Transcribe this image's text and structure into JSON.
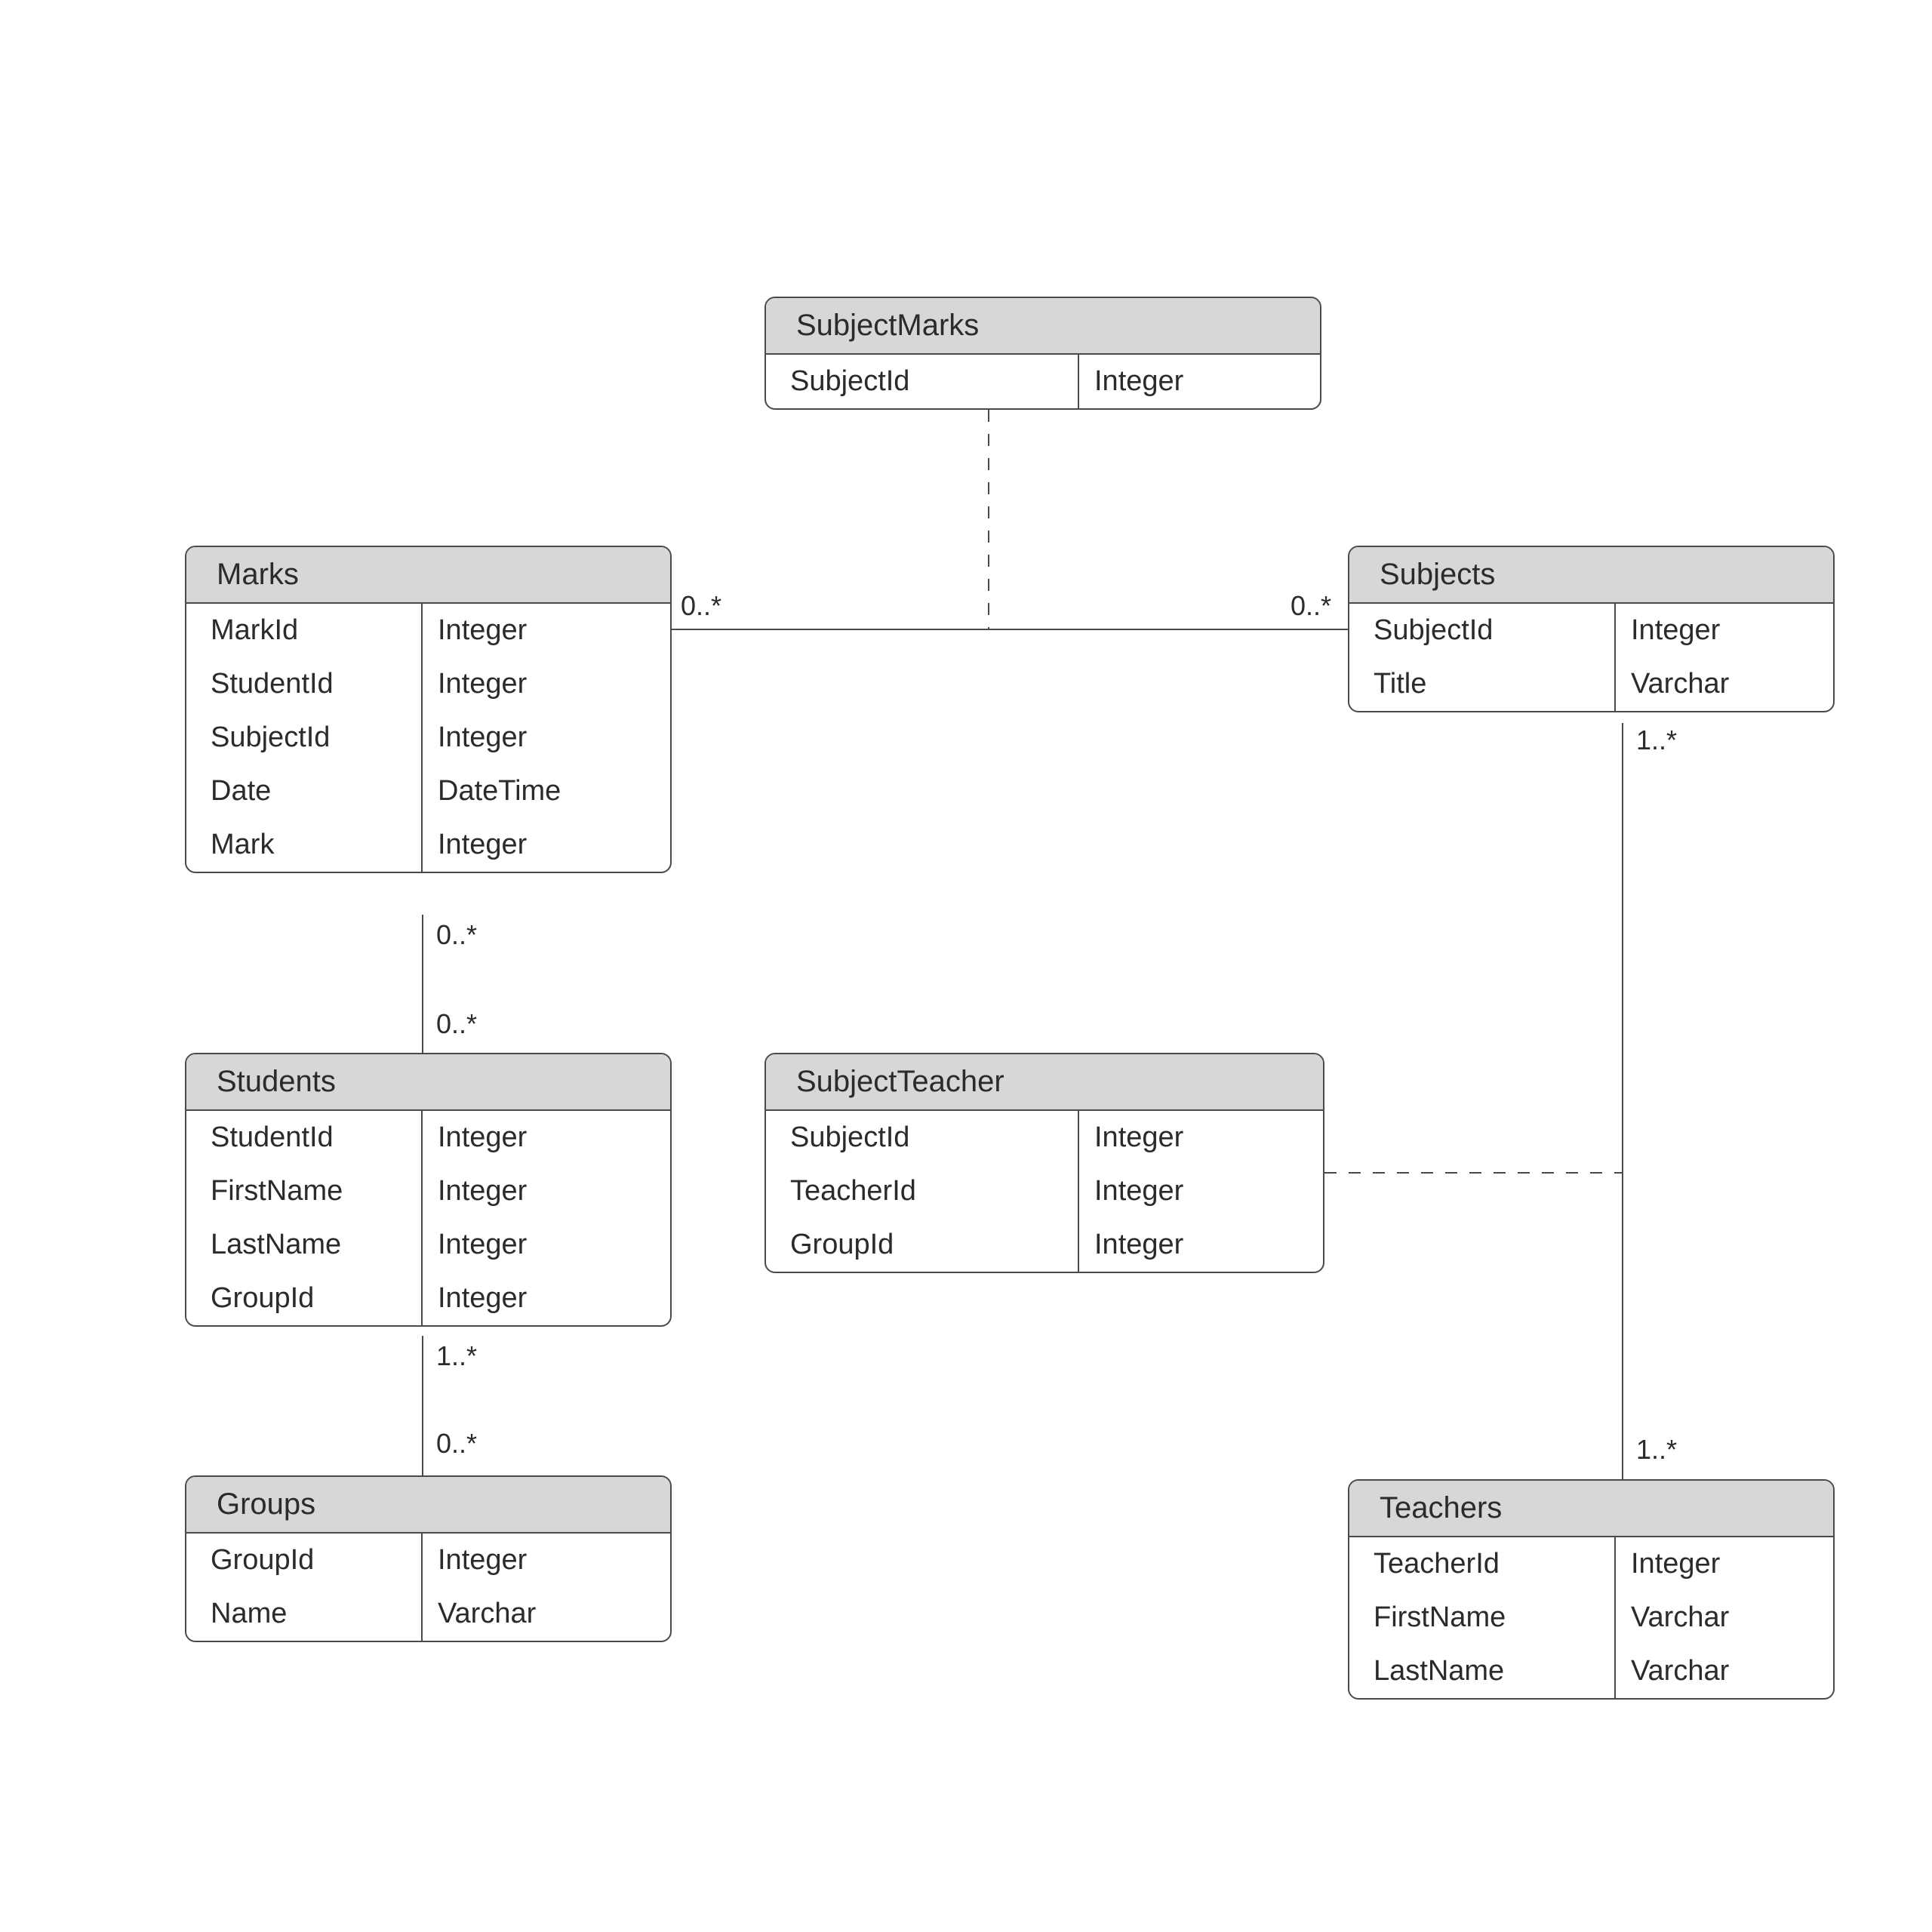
{
  "entities": {
    "subjectMarks": {
      "title": "SubjectMarks",
      "rows": [
        {
          "name": "SubjectId",
          "type": "Integer"
        }
      ]
    },
    "marks": {
      "title": "Marks",
      "rows": [
        {
          "name": "MarkId",
          "type": "Integer"
        },
        {
          "name": "StudentId",
          "type": "Integer"
        },
        {
          "name": "SubjectId",
          "type": "Integer"
        },
        {
          "name": "Date",
          "type": "DateTime"
        },
        {
          "name": "Mark",
          "type": "Integer"
        }
      ]
    },
    "subjects": {
      "title": "Subjects",
      "rows": [
        {
          "name": "SubjectId",
          "type": "Integer"
        },
        {
          "name": "Title",
          "type": "Varchar"
        }
      ]
    },
    "students": {
      "title": "Students",
      "rows": [
        {
          "name": "StudentId",
          "type": "Integer"
        },
        {
          "name": "FirstName",
          "type": "Integer"
        },
        {
          "name": "LastName",
          "type": "Integer"
        },
        {
          "name": "GroupId",
          "type": "Integer"
        }
      ]
    },
    "subjectTeacher": {
      "title": "SubjectTeacher",
      "rows": [
        {
          "name": "SubjectId",
          "type": "Integer"
        },
        {
          "name": "TeacherId",
          "type": "Integer"
        },
        {
          "name": "GroupId",
          "type": "Integer"
        }
      ]
    },
    "groups": {
      "title": "Groups",
      "rows": [
        {
          "name": "GroupId",
          "type": "Integer"
        },
        {
          "name": "Name",
          "type": "Varchar"
        }
      ]
    },
    "teachers": {
      "title": "Teachers",
      "rows": [
        {
          "name": "TeacherId",
          "type": "Integer"
        },
        {
          "name": "FirstName",
          "type": "Varchar"
        },
        {
          "name": "LastName",
          "type": "Varchar"
        }
      ]
    }
  },
  "multiplicities": {
    "marks_to_subjects_left": "0..*",
    "marks_to_subjects_right": "0..*",
    "marks_to_students_top": "0..*",
    "marks_to_students_bottom": "0..*",
    "students_to_groups_top": "1..*",
    "students_to_groups_bottom": "0..*",
    "subjects_to_teachers_top": "1..*",
    "subjects_to_teachers_bottom": "1..*"
  },
  "relationships": [
    {
      "from": "Marks",
      "to": "Subjects",
      "style": "solid",
      "via": "SubjectMarks"
    },
    {
      "from": "Marks",
      "to": "Students",
      "style": "solid"
    },
    {
      "from": "Students",
      "to": "Groups",
      "style": "solid"
    },
    {
      "from": "Subjects",
      "to": "Teachers",
      "style": "solid",
      "via": "SubjectTeacher"
    }
  ]
}
